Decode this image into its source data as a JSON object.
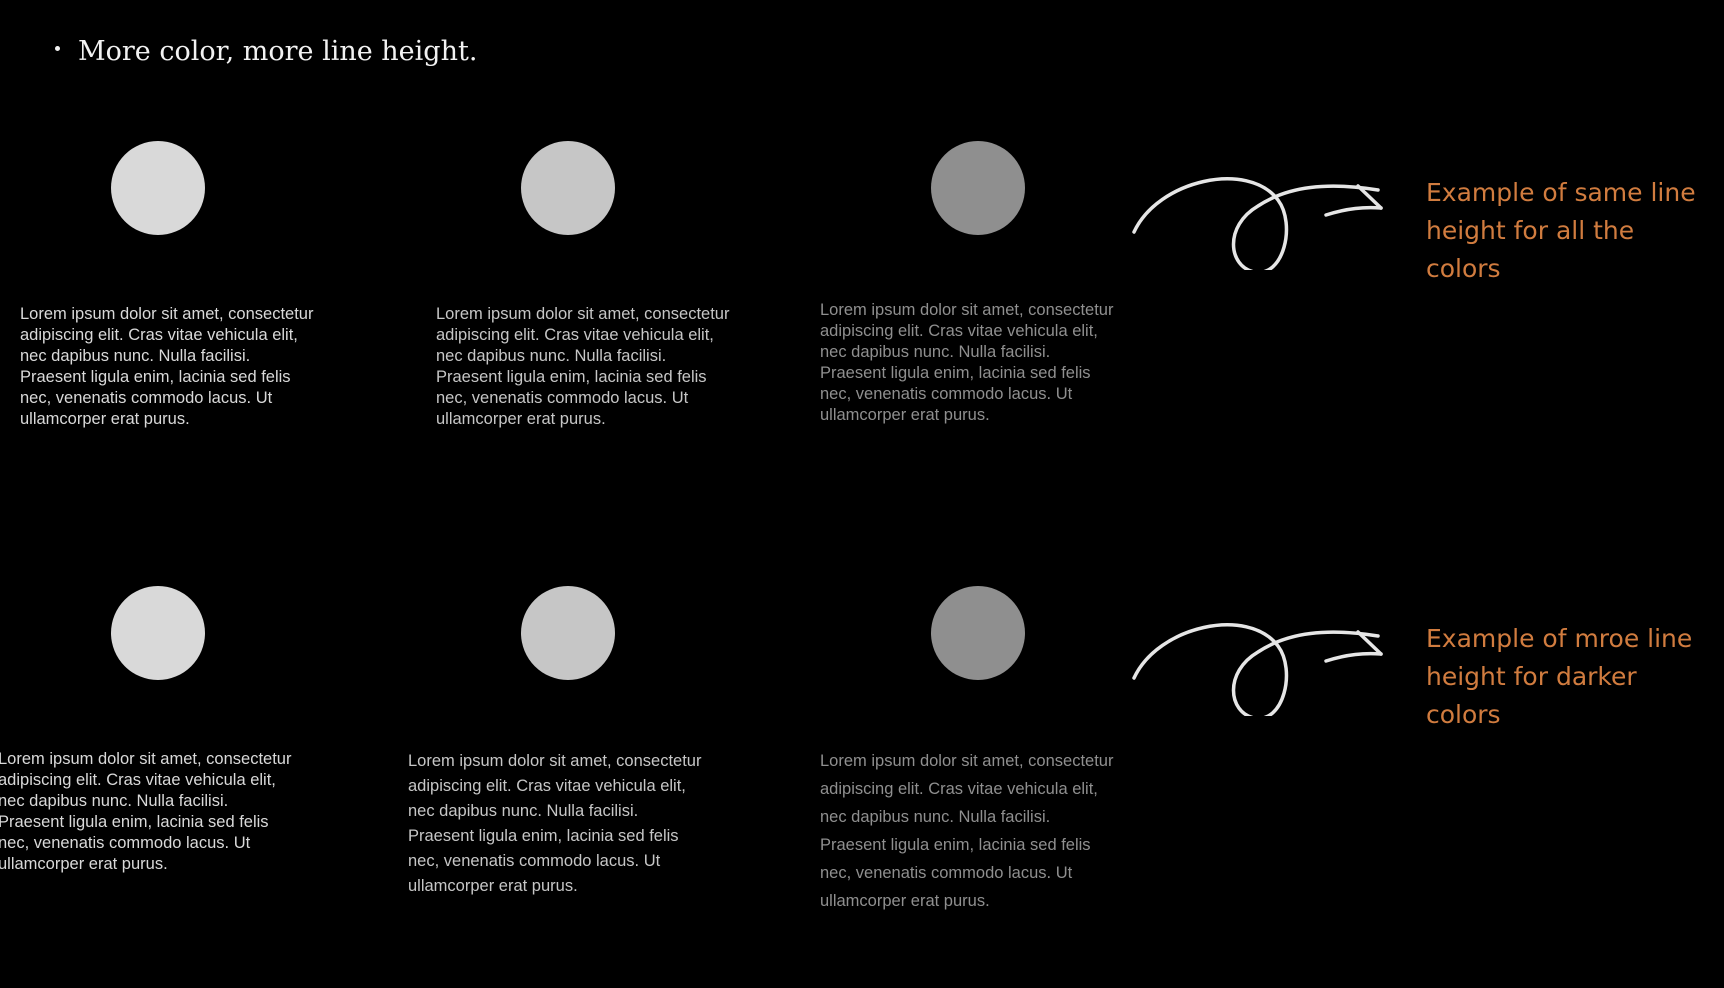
{
  "heading": "More color, more line height.",
  "colors": {
    "light": "#d9d9d9",
    "mid": "#c6c6c6",
    "dark": "#8f8f8f",
    "annotation": "#d17c3f",
    "arrow": "#e6e6e6"
  },
  "icons": {
    "arrow": "curly-arrow-icon"
  },
  "rows": [
    {
      "note": [
        "Example of same line",
        "height for all the",
        "colors"
      ],
      "columns": [
        {
          "lines": [
            "Lorem ipsum dolor sit amet, consectetur",
            "adipiscing elit. Cras vitae vehicula elit,",
            "nec dapibus nunc. Nulla facilisi.",
            "Praesent ligula enim, lacinia sed felis",
            "nec, venenatis commodo lacus. Ut",
            "ullamcorper erat purus."
          ]
        },
        {
          "lines": [
            "Lorem ipsum dolor sit amet, consectetur",
            "adipiscing elit. Cras vitae vehicula elit,",
            "nec dapibus nunc. Nulla facilisi.",
            "Praesent ligula enim, lacinia sed felis",
            "nec, venenatis commodo lacus. Ut",
            "ullamcorper erat purus."
          ]
        },
        {
          "lines": [
            "Lorem ipsum dolor sit amet, consectetur",
            "adipiscing elit. Cras vitae vehicula elit,",
            "nec dapibus nunc. Nulla facilisi.",
            "Praesent ligula enim, lacinia sed felis",
            "nec, venenatis commodo lacus. Ut",
            "ullamcorper erat purus."
          ]
        }
      ]
    },
    {
      "note": [
        "Example of mroe line",
        "height for darker",
        "colors"
      ],
      "columns": [
        {
          "lines": [
            "Lorem ipsum dolor sit amet, consectetur",
            "adipiscing elit. Cras vitae vehicula elit,",
            "nec dapibus nunc. Nulla facilisi.",
            "Praesent ligula enim, lacinia sed felis",
            "nec, venenatis commodo lacus. Ut",
            "ullamcorper erat purus."
          ]
        },
        {
          "lines": [
            "Lorem ipsum dolor sit amet, consectetur",
            "adipiscing elit. Cras vitae vehicula elit,",
            "nec dapibus nunc. Nulla facilisi.",
            "Praesent ligula enim, lacinia sed felis",
            "nec, venenatis commodo lacus. Ut",
            "ullamcorper erat purus."
          ]
        },
        {
          "lines": [
            "Lorem ipsum dolor sit amet, consectetur",
            "adipiscing elit. Cras vitae vehicula elit,",
            "nec dapibus nunc. Nulla facilisi.",
            "Praesent ligula enim, lacinia sed felis",
            "nec, venenatis commodo lacus. Ut",
            "ullamcorper erat purus."
          ]
        }
      ]
    }
  ]
}
